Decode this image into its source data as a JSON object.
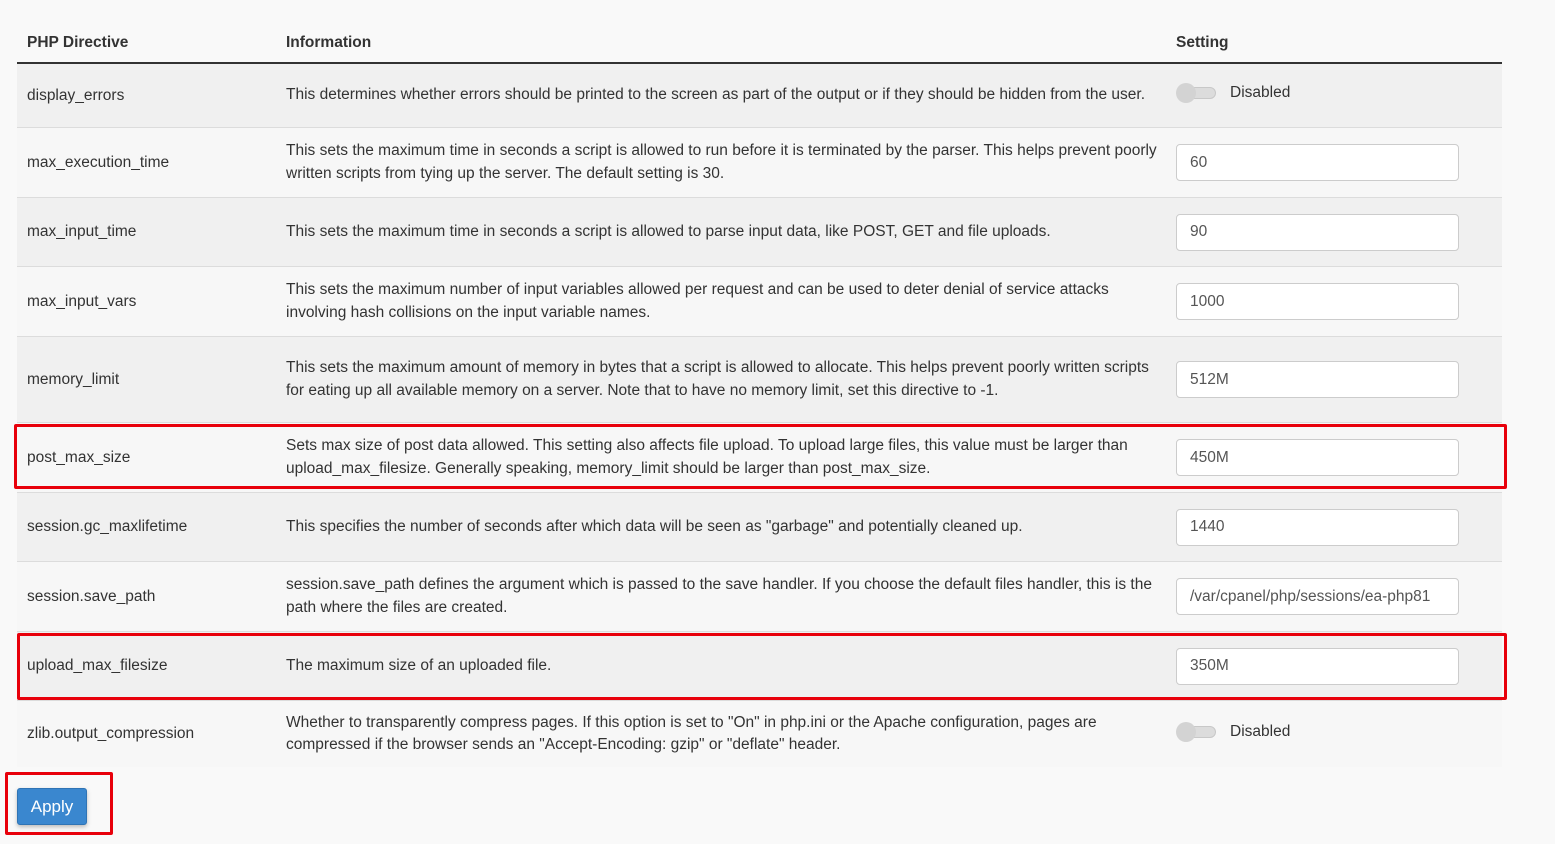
{
  "table": {
    "headers": {
      "directive": "PHP Directive",
      "information": "Information",
      "setting": "Setting"
    },
    "rows": [
      {
        "directive": "display_errors",
        "information": "This determines whether errors should be printed to the screen as part of the output or if they should be hidden from the user.",
        "type": "toggle",
        "value": "Disabled"
      },
      {
        "directive": "max_execution_time",
        "information": "This sets the maximum time in seconds a script is allowed to run before it is terminated by the parser. This helps prevent poorly written scripts from tying up the server. The default setting is 30.",
        "type": "input",
        "value": "60"
      },
      {
        "directive": "max_input_time",
        "information": "This sets the maximum time in seconds a script is allowed to parse input data, like POST, GET and file uploads.",
        "type": "input",
        "value": "90"
      },
      {
        "directive": "max_input_vars",
        "information": "This sets the maximum number of input variables allowed per request and can be used to deter denial of service attacks involving hash collisions on the input variable names.",
        "type": "input",
        "value": "1000"
      },
      {
        "directive": "memory_limit",
        "information": "This sets the maximum amount of memory in bytes that a script is allowed to allocate. This helps prevent poorly written scripts for eating up all available memory on a server. Note that to have no memory limit, set this directive to -1.",
        "type": "input",
        "value": "512M"
      },
      {
        "directive": "post_max_size",
        "information": "Sets max size of post data allowed. This setting also affects file upload. To upload large files, this value must be larger than upload_max_filesize. Generally speaking, memory_limit should be larger than post_max_size.",
        "type": "input",
        "value": "450M"
      },
      {
        "directive": "session.gc_maxlifetime",
        "information": "This specifies the number of seconds after which data will be seen as \"garbage\" and potentially cleaned up.",
        "type": "input",
        "value": "1440"
      },
      {
        "directive": "session.save_path",
        "information": "session.save_path defines the argument which is passed to the save handler. If you choose the default files handler, this is the path where the files are created.",
        "type": "input",
        "value": "/var/cpanel/php/sessions/ea-php81"
      },
      {
        "directive": "upload_max_filesize",
        "information": "The maximum size of an uploaded file.",
        "type": "input",
        "value": "350M"
      },
      {
        "directive": "zlib.output_compression",
        "information": "Whether to transparently compress pages. If this option is set to \"On\" in php.ini or the Apache configuration, pages are compressed if the browser sends an \"Accept-Encoding: gzip\" or \"deflate\" header.",
        "type": "toggle",
        "value": "Disabled"
      }
    ]
  },
  "apply_label": "Apply",
  "colors": {
    "highlight": "#e8000b",
    "button": "#3a87cf"
  }
}
